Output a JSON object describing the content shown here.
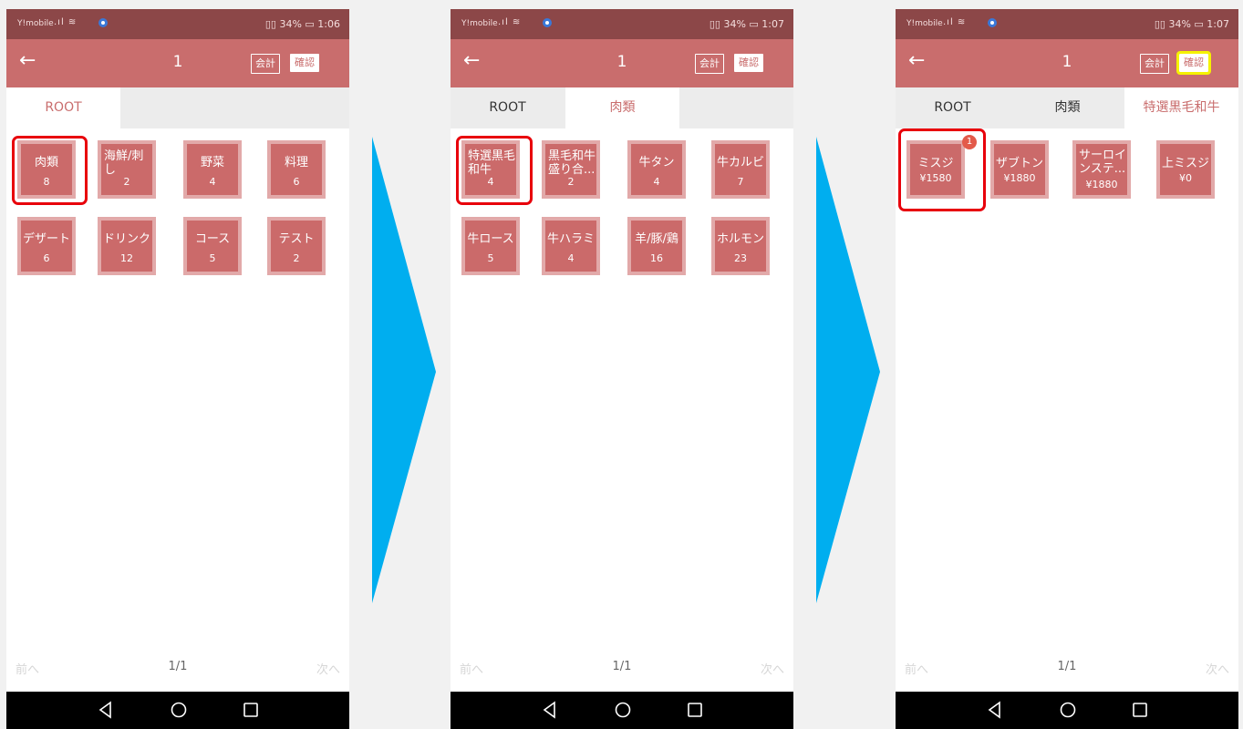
{
  "arrow_color": "#00aeef",
  "screens": [
    {
      "status": {
        "carrier": "Y!mobile",
        "battery": "34%",
        "time": "1:06"
      },
      "appbar": {
        "title": "1",
        "bill_label": "会計",
        "confirm_label": "確認"
      },
      "tabs": [
        "ROOT"
      ],
      "active_tab": 0,
      "tiles": [
        {
          "name": "肉類",
          "sub": "8"
        },
        {
          "name": "海鮮/刺し",
          "sub": "2"
        },
        {
          "name": "野菜",
          "sub": "4"
        },
        {
          "name": "料理",
          "sub": "6"
        },
        {
          "name": "デザート",
          "sub": "6"
        },
        {
          "name": "ドリンク",
          "sub": "12"
        },
        {
          "name": "コース",
          "sub": "5"
        },
        {
          "name": "テスト",
          "sub": "2"
        }
      ],
      "pager": {
        "prev": "前へ",
        "page": "1/1",
        "next": "次へ"
      }
    },
    {
      "status": {
        "carrier": "Y!mobile",
        "battery": "34%",
        "time": "1:07"
      },
      "appbar": {
        "title": "1",
        "bill_label": "会計",
        "confirm_label": "確認"
      },
      "tabs": [
        "ROOT",
        "肉類"
      ],
      "active_tab": 1,
      "tiles": [
        {
          "name": "特選黒毛和牛",
          "sub": "4"
        },
        {
          "name": "黒毛和牛盛り合...",
          "sub": "2"
        },
        {
          "name": "牛タン",
          "sub": "4"
        },
        {
          "name": "牛カルビ",
          "sub": "7"
        },
        {
          "name": "牛ロース",
          "sub": "5"
        },
        {
          "name": "牛ハラミ",
          "sub": "4"
        },
        {
          "name": "羊/豚/鶏",
          "sub": "16"
        },
        {
          "name": "ホルモン",
          "sub": "23"
        }
      ],
      "pager": {
        "prev": "前へ",
        "page": "1/1",
        "next": "次へ"
      }
    },
    {
      "status": {
        "carrier": "Y!mobile",
        "battery": "34%",
        "time": "1:07"
      },
      "appbar": {
        "title": "1",
        "bill_label": "会計",
        "confirm_label": "確認"
      },
      "tabs": [
        "ROOT",
        "肉類",
        "特選黒毛和牛"
      ],
      "active_tab": 2,
      "tiles": [
        {
          "name": "ミスジ",
          "sub": "¥1580",
          "badge": "1"
        },
        {
          "name": "ザブトン",
          "sub": "¥1880"
        },
        {
          "name": "サーロインステ...",
          "sub": "¥1880"
        },
        {
          "name": "上ミスジ",
          "sub": "¥0"
        }
      ],
      "pager": {
        "prev": "前へ",
        "page": "1/1",
        "next": "次へ"
      }
    }
  ]
}
